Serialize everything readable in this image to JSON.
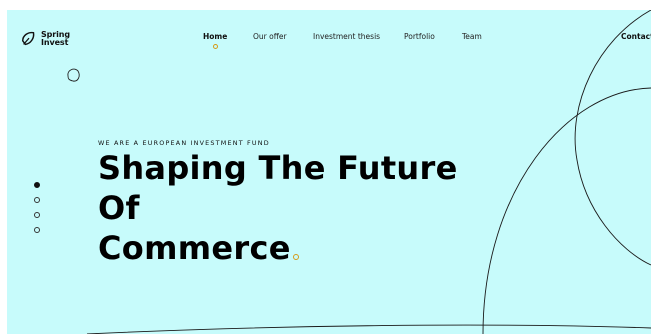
{
  "brand": {
    "name_line1": "Spring",
    "name_line2": "Invest"
  },
  "nav": {
    "items": [
      {
        "label": "Home",
        "active": true
      },
      {
        "label": "Our offer",
        "active": false
      },
      {
        "label": "Investment thesis",
        "active": false
      },
      {
        "label": "Portfolio",
        "active": false
      },
      {
        "label": "Team",
        "active": false
      }
    ],
    "contact_label": "Contact"
  },
  "hero": {
    "eyebrow": "WE ARE A EUROPEAN INVESTMENT FUND",
    "headline_lines": [
      "Shaping The Future",
      "Of",
      "Commerce."
    ]
  },
  "pager": {
    "count": 4,
    "active_index": 0
  },
  "colors": {
    "background": "#c7fbfb",
    "accent": "#d49a18",
    "text": "#000000"
  }
}
